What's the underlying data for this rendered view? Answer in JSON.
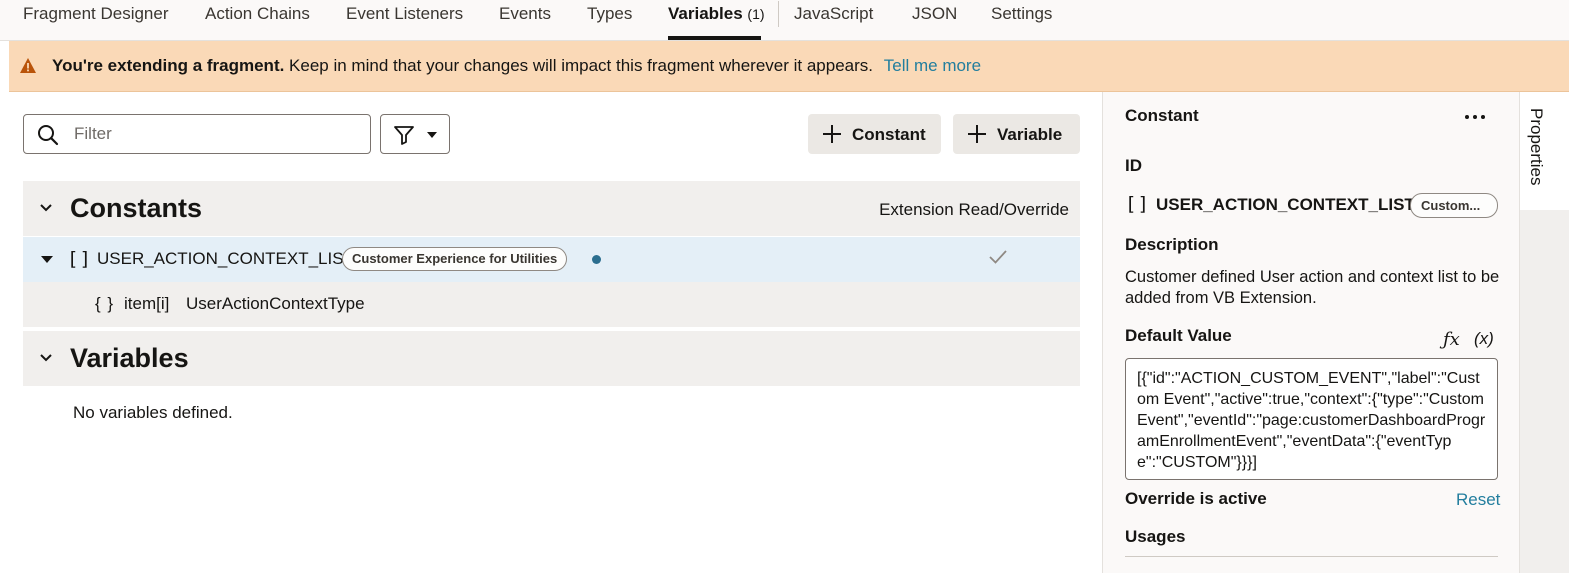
{
  "tabs": [
    {
      "label": "Fragment Designer"
    },
    {
      "label": "Action Chains"
    },
    {
      "label": "Event Listeners"
    },
    {
      "label": "Events"
    },
    {
      "label": "Types"
    },
    {
      "label": "Variables",
      "count": "(1)",
      "active": true
    },
    {
      "label": "JavaScript"
    },
    {
      "label": "JSON"
    },
    {
      "label": "Settings"
    }
  ],
  "banner": {
    "bold": "You're extending a fragment.",
    "text": " Keep in mind that your changes will impact this fragment wherever it appears.",
    "link": "Tell me more",
    "icon": "warning-icon",
    "color": "#fad9b7"
  },
  "toolbar": {
    "filter_placeholder": "Filter",
    "filter_value": "",
    "add_constant_label": "Constant",
    "add_variable_label": "Variable"
  },
  "constants": {
    "title": "Constants",
    "column_header": "Extension Read/Override",
    "rows": [
      {
        "type_symbol": "[]",
        "name": "USER_ACTION_CONTEXT_LIST",
        "badge": "Customer Experience for Utilities",
        "modified": true,
        "read_override": true,
        "children": [
          {
            "type_symbol": "{ }",
            "name": "item[i]",
            "type": "UserActionContextType"
          }
        ]
      }
    ]
  },
  "variables": {
    "title": "Variables",
    "empty_message": "No variables defined."
  },
  "panel": {
    "title": "Constant",
    "id_label": "ID",
    "id_symbol": "[]",
    "id_value": "USER_ACTION_CONTEXT_LIST",
    "id_badge": "Custom...",
    "description_label": "Description",
    "description": "Customer defined User action and context list to be added from VB Extension.",
    "default_value_label": "Default Value",
    "fx_label": "ƒx",
    "var_label": "(x)",
    "default_value": "[{\"id\":\"ACTION_CUSTOM_EVENT\",\"label\":\"Custom Event\",\"active\":true,\"context\":{\"type\":\"CustomEvent\",\"eventId\":\"page:customerDashboardProgramEnrollmentEvent\",\"eventData\":{\"eventType\":\"CUSTOM\"}}}]",
    "override_label": "Override is active",
    "reset_label": "Reset",
    "usages_label": "Usages"
  },
  "rail": {
    "properties_label": "Properties"
  },
  "colors": {
    "accent_link": "#227e9e",
    "selected_row": "#e4eff7",
    "modified_dot": "#2b6e8f"
  }
}
